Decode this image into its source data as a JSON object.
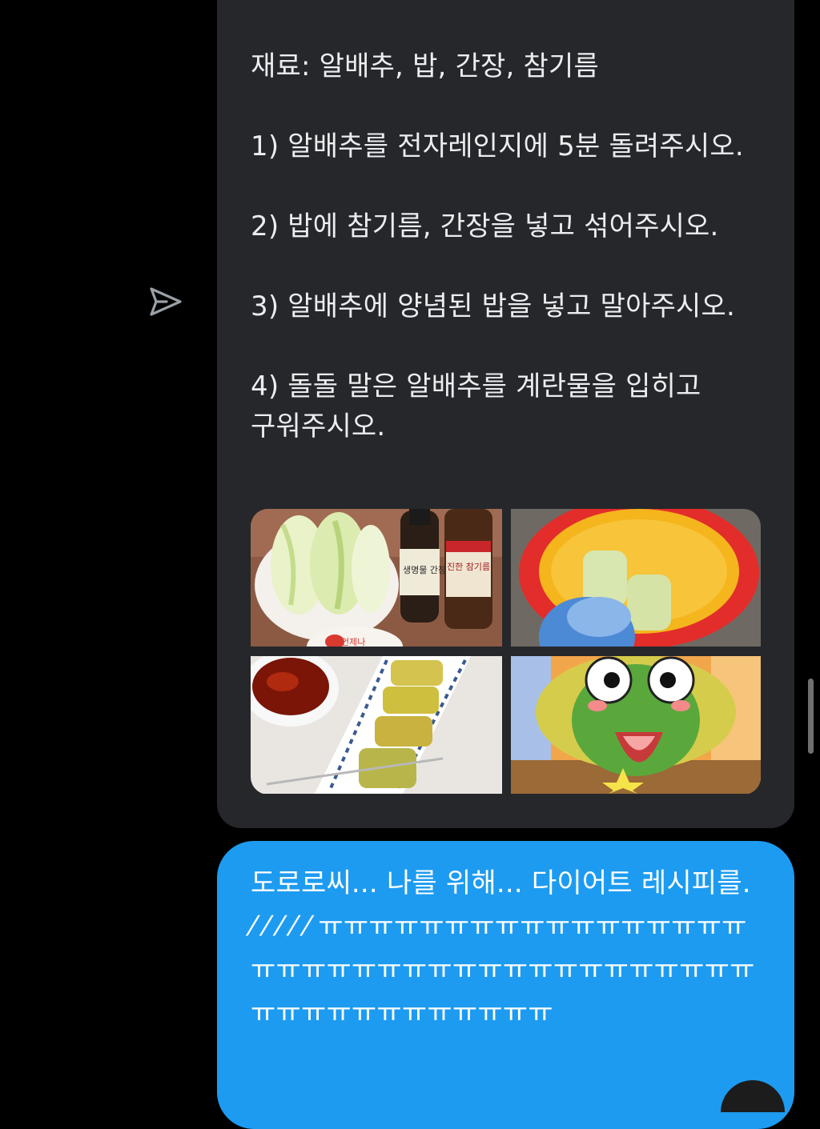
{
  "incoming": {
    "ingredients": "재료: 알배추, 밥, 간장, 참기름",
    "step1": "1) 알배추를 전자레인지에 5분 돌려주시오.",
    "step2": "2) 밥에 참기름, 간장을 넣고 섞어주시오.",
    "step3": "3) 알배추에 양념된 밥을 넣고 말아주시오.",
    "step4": "4) 돌돌 말은 알배추를 계란물을 입히고 구워주시오.",
    "images": {
      "photo1": {
        "bottle1_label": "생명물 간장",
        "bottle2_label": "진한 참기름",
        "bowl_label": "언제나"
      }
    }
  },
  "outgoing": {
    "text": "도로로씨... 나를 위해... 다이어트 레시피를.  ⁄  ⁄  ⁄  ⁄  ⁄ ㅠㅠㅠㅠㅠㅠㅠㅠㅠㅠㅠㅠㅠㅠㅠㅠㅠㅠㅠㅠㅠㅠㅠㅠㅠㅠㅠㅠㅠㅠㅠㅠㅠㅠㅠㅠㅠㅠㅠㅠㅠㅠㅠㅠㅠㅠㅠㅠㅠ"
  },
  "colors": {
    "background": "#000000",
    "incoming_bubble": "#25272b",
    "outgoing_bubble": "#1d9bf0"
  }
}
